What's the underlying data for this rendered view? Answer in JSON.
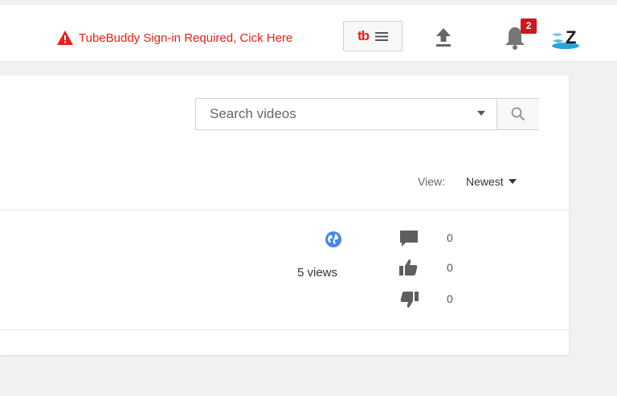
{
  "header": {
    "tubebuddy_warning": "TubeBuddy Sign-in Required, Cick Here",
    "tubebuddy_logo": "tb",
    "notification_count": "2",
    "avatar_text": "Z"
  },
  "search": {
    "placeholder": "Search videos",
    "value": ""
  },
  "sort": {
    "label": "View:",
    "selected": "Newest"
  },
  "video": {
    "views": "5 views",
    "comments": "0",
    "likes": "0",
    "dislikes": "0",
    "visibility": "globe-icon"
  },
  "colors": {
    "warning_red": "#e62117",
    "badge_red": "#cc181e",
    "globe_blue": "#4a86e8",
    "icon_gray": "#5f5f5f"
  }
}
